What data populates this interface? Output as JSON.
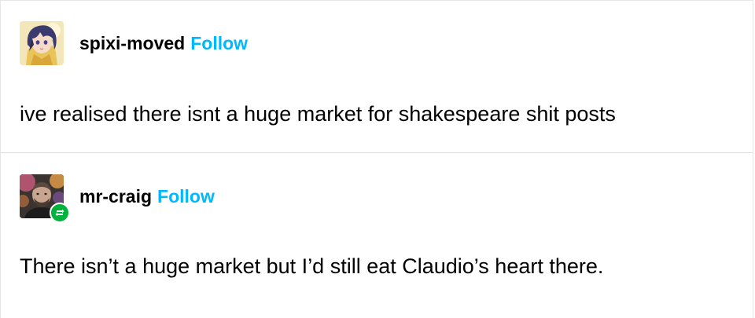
{
  "posts": [
    {
      "username": "spixi-moved",
      "follow_label": "Follow",
      "body": "ive realised there isnt a huge market for shakespeare shit posts",
      "avatar_icon": "anime-avatar-icon",
      "reblog": false
    },
    {
      "username": "mr-craig",
      "follow_label": "Follow",
      "body": "There isn’t a huge market but I’d still eat Claudio’s heart there.",
      "avatar_icon": "photo-avatar-icon",
      "reblog": true,
      "badge_icon": "reblog-icon"
    }
  ],
  "colors": {
    "follow": "#00b8ff",
    "reblog_badge": "#00b33c",
    "divider": "#dcdcdc"
  }
}
